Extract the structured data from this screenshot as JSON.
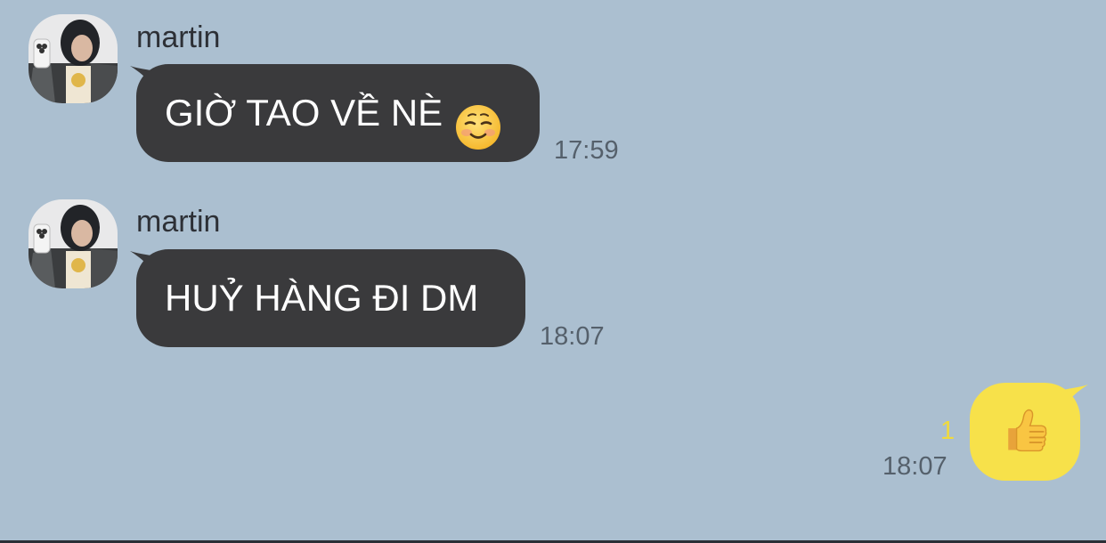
{
  "messages": [
    {
      "sender": "martin",
      "text": "GIỜ TAO VỀ NÈ",
      "emoji": "smiling-face-icon",
      "time": "17:59",
      "direction": "incoming"
    },
    {
      "sender": "martin",
      "text": "HUỶ HÀNG ĐI DM",
      "time": "18:07",
      "direction": "incoming"
    },
    {
      "emoji": "thumbs-up-icon",
      "time": "18:07",
      "unread_count": "1",
      "direction": "outgoing"
    }
  ],
  "colors": {
    "background": "#abbfd0",
    "incoming_bubble": "#3a3a3c",
    "outgoing_bubble": "#f7e14a",
    "unread": "#f0da3c"
  }
}
